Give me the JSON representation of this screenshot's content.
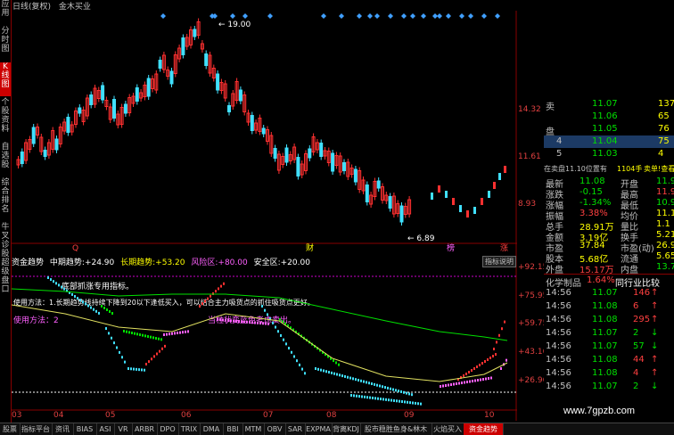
{
  "title_bar": {
    "mode": "日线(复权)",
    "signal": "金木买业"
  },
  "left_tabs": [
    "应用",
    "分时图",
    "K线图",
    "个股资料",
    "自选股",
    "综合排名",
    "牛叉诊股",
    "超级盘口"
  ],
  "left_tab_active": 2,
  "price_axis": [
    "14.32",
    "11.61",
    "8.93"
  ],
  "price_annotations": {
    "high": "19.00",
    "low": "6.89"
  },
  "chart_event_labels": [
    "Q",
    "财",
    "榜",
    "涨"
  ],
  "indicator": {
    "name": "资金趋势",
    "mid_label": "中期趋势:",
    "mid_value": "+24.90",
    "long_label": "长期趋势:",
    "long_value": "+53.20",
    "risk_label": "风险区:",
    "risk_value": "+80.00",
    "safe_label": "安全区:",
    "safe_value": "+20.00",
    "button": "指标说明",
    "axis": [
      "+92.15",
      "+75.95",
      "+59.75",
      "+43.16",
      "+26.96"
    ],
    "note1": "底部抓涨专用指标。",
    "note2": "使用方法：1.长期趋势线持续下降到20以下逢低买入，可以结合主力吸货点的抓住吸货点更好。",
    "note3": "使用方法：2",
    "note4": "当柱状变蓝色考虑卖出。"
  },
  "months": [
    "03",
    "04",
    "05",
    "06",
    "07",
    "08",
    "09",
    "10"
  ],
  "order_book": {
    "sell": [
      {
        "label": "卖",
        "level": "",
        "price": "11.07",
        "vol": "137"
      },
      {
        "label": "",
        "level": "",
        "price": "11.06",
        "vol": "65"
      },
      {
        "label": "盘",
        "level": "",
        "price": "11.05",
        "vol": "76"
      },
      {
        "label": "",
        "level": "4",
        "price": "11.04",
        "vol": "75"
      },
      {
        "label": "",
        "level": "5",
        "price": "11.03",
        "vol": "4"
      }
    ],
    "weibi_text": "在卖盘11.10位置有",
    "weibi_vol": "1104手",
    "weibi_link": "卖单!查看详单",
    "quotes": [
      [
        "最新",
        "11.08",
        "开盘",
        "11.9"
      ],
      [
        "涨跌",
        "-0.15",
        "最高",
        "11.9"
      ],
      [
        "涨幅",
        "-1.34%",
        "最低",
        "10.9"
      ],
      [
        "振幅",
        "3.38%",
        "均价",
        "11.1"
      ],
      [
        "总手",
        "28.91万",
        "量比",
        "1.1"
      ],
      [
        "金额",
        "3.19亿",
        "换手",
        "5.21"
      ],
      [
        "市盈",
        "37.84",
        "市盈(动)",
        "26.9"
      ],
      [
        "股本",
        "5.68亿",
        "流通",
        "5.65"
      ],
      [
        "外盘",
        "15.17万",
        "内盘",
        "13.7"
      ]
    ],
    "sector": "化学制品",
    "sector_change": "1.64%",
    "compare": "同行业比较",
    "ticks": [
      [
        "14:56",
        "11.07",
        "146"
      ],
      [
        "14:56",
        "11.08",
        "6"
      ],
      [
        "14:56",
        "11.08",
        "295"
      ],
      [
        "14:56",
        "11.07",
        "2"
      ],
      [
        "14:56",
        "11.07",
        "57"
      ],
      [
        "14:56",
        "11.08",
        "44"
      ],
      [
        "14:56",
        "11.08",
        "4"
      ],
      [
        "14:56",
        "11.07",
        "2"
      ]
    ]
  },
  "bottom_tabs": [
    "股票",
    "指标平台",
    "资讯",
    "BIAS",
    "ASI",
    "VR",
    "ARBR",
    "DPO",
    "TRIX",
    "DMA",
    "BBI",
    "MTM",
    "OBV",
    "SAR",
    "EXPMA",
    "背离KDJ",
    "股市稳胜鱼身&林木",
    "火焰买入",
    "资金趋势"
  ],
  "bottom_tab_active": 18,
  "watermark": "www.7gpzb.com"
}
